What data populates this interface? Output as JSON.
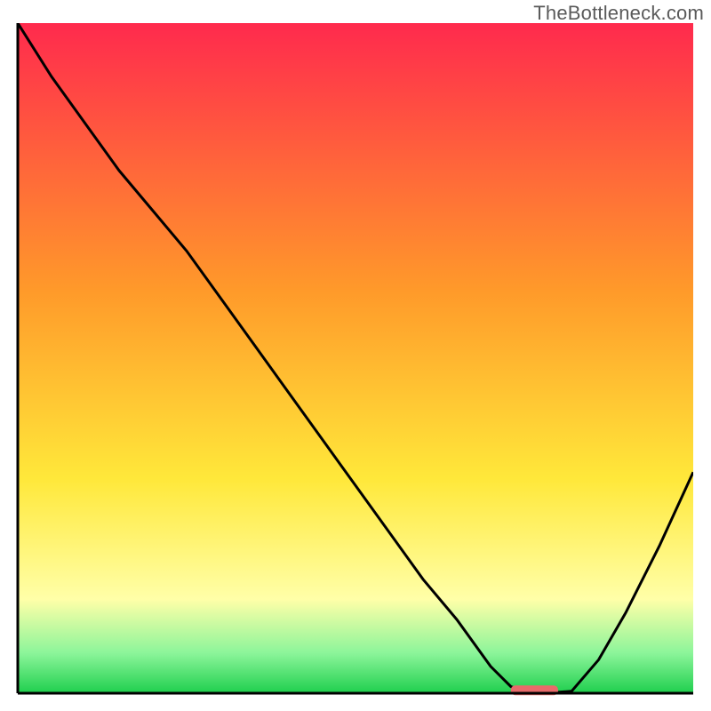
{
  "watermark": "TheBottleneck.com",
  "colors": {
    "curve": "#000000",
    "marker": "#e86a6a",
    "axis": "#000000",
    "grad_top": "#ff2a4d",
    "grad_mid1": "#ff9a2a",
    "grad_mid2": "#ffe83a",
    "grad_pale": "#ffffa8",
    "grad_green_light": "#8cf59a",
    "grad_green": "#1fcf4e"
  },
  "chart_data": {
    "type": "line",
    "title": "",
    "xlabel": "",
    "ylabel": "",
    "xlim": [
      0,
      100
    ],
    "ylim": [
      0,
      100
    ],
    "x": [
      0,
      5,
      10,
      15,
      20,
      25,
      30,
      35,
      40,
      45,
      50,
      55,
      60,
      65,
      70,
      73,
      76,
      78,
      82,
      86,
      90,
      95,
      100
    ],
    "y": [
      100,
      92,
      85,
      78,
      72,
      66,
      59,
      52,
      45,
      38,
      31,
      24,
      17,
      11,
      4,
      1,
      0,
      0,
      0.3,
      5,
      12,
      22,
      33
    ],
    "marker": {
      "x_start": 73,
      "x_end": 80,
      "y": 0.5
    },
    "comment": "Values approximated from pixel positions; y is bottleneck-% style metric, 0 = optimal (green), 100 = worst (red)."
  }
}
